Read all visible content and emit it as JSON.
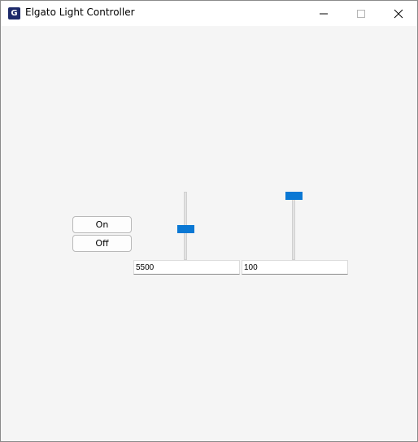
{
  "window": {
    "title": "Elgato Light Controller",
    "app_icon_glyph": "G"
  },
  "titlebar_icons": {
    "minimize": "minimize-icon",
    "maximize": "maximize-icon",
    "close": "close-icon"
  },
  "controls": {
    "on_label": "On",
    "off_label": "Off",
    "temperature": {
      "value": "5500",
      "slider_fraction": 0.44
    },
    "brightness": {
      "value": "100",
      "slider_fraction": 1.0
    }
  },
  "colors": {
    "accent": "#0a78d4",
    "app_icon_bg": "#1d2a6a"
  }
}
